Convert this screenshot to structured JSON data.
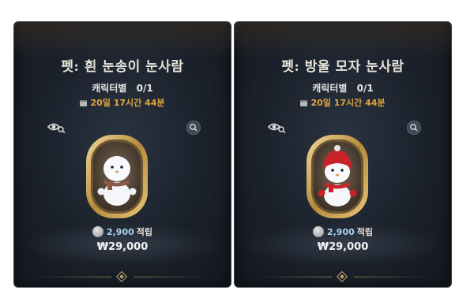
{
  "items": [
    {
      "title": "펫: 흰 눈송이 눈사람",
      "limit_label": "캐릭터별",
      "limit_value": "0/1",
      "period": "20일 17시간 44분",
      "points": "2,900",
      "points_unit": "적립",
      "price": "₩29,000",
      "hat": false
    },
    {
      "title": "펫: 방울 모자 눈사람",
      "limit_label": "캐릭터별",
      "limit_value": "0/1",
      "period": "20일 17시간 44분",
      "points": "2,900",
      "points_unit": "적립",
      "price": "₩29,000",
      "hat": true
    }
  ],
  "icons": {
    "preview": "eye-icon",
    "zoom": "magnifier-icon",
    "calendar": "calendar-icon",
    "points": "mileage-coin-icon",
    "divider": "diamond-ornament"
  },
  "colors": {
    "panel_bg": "#1b212b",
    "title": "#e8e4da",
    "period": "#e0a640",
    "points": "#a9d4ee",
    "frame_gold": "#c9a35a",
    "hat_red": "#c8232a"
  }
}
